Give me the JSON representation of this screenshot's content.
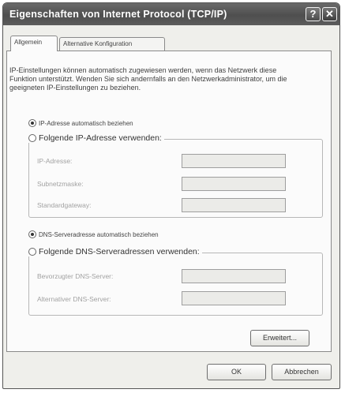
{
  "window": {
    "title": "Eigenschaften von Internet Protocol (TCP/IP)",
    "help_label": "?",
    "close_label": "✕"
  },
  "tabs": [
    {
      "label": "Allgemein",
      "active": true
    },
    {
      "label": "Alternative Konfiguration",
      "active": false
    }
  ],
  "intro_text": "IP-Einstellungen können automatisch zugewiesen werden, wenn das Netzwerk diese Funktion unterstützt. Wenden Sie sich andernfalls an den Netzwerkadministrator, um die geeigneten IP-Einstellungen zu beziehen.",
  "ip_section": {
    "auto_label": "IP-Adresse automatisch beziehen",
    "auto_selected": true,
    "manual_label": "Folgende IP-Adresse verwenden:",
    "manual_selected": false,
    "fields": [
      {
        "label": "IP-Adresse:",
        "value": ""
      },
      {
        "label": "Subnetzmaske:",
        "value": ""
      },
      {
        "label": "Standardgateway:",
        "value": ""
      }
    ]
  },
  "dns_section": {
    "auto_label": "DNS-Serveradresse automatisch beziehen",
    "auto_selected": true,
    "manual_label": "Folgende DNS-Serveradressen verwenden:",
    "manual_selected": false,
    "fields": [
      {
        "label": "Bevorzugter DNS-Server:",
        "value": ""
      },
      {
        "label": "Alternativer DNS-Server:",
        "value": ""
      }
    ]
  },
  "buttons": {
    "advanced": "Erweitert...",
    "ok": "OK",
    "cancel": "Abbrechen"
  }
}
